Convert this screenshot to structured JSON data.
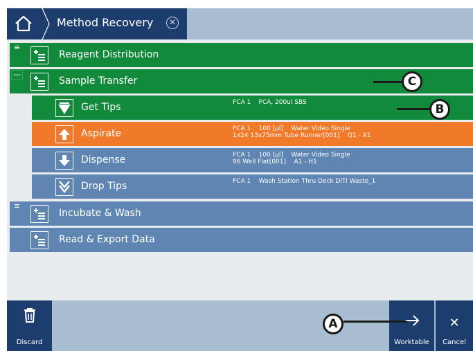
{
  "header": {
    "title": "Method Recovery"
  },
  "tree": [
    {
      "label": "Reagent Distribution",
      "expander": "≡"
    },
    {
      "label": "Sample Transfer",
      "expander": "—",
      "steps": [
        {
          "label": "Get Tips",
          "detail": "FCA 1    FCA, 200ul SBS",
          "icon": "get-tips-icon"
        },
        {
          "label": "Aspirate",
          "detail": "FCA 1    100 [µl]    Water Video Single\n1x24 13x75mm Tube Runner[001]    Q1 - X1",
          "icon": "aspirate-arrow-up-icon"
        },
        {
          "label": "Dispense",
          "detail": "FCA 1    100 [µl]    Water Video Single\n96 Well Flat[001]    A1 - H1",
          "icon": "dispense-arrow-down-icon"
        },
        {
          "label": "Drop Tips",
          "detail": "FCA 1    Wash Station Thru Deck DiTi Waste_1",
          "icon": "drop-tips-icon"
        }
      ]
    },
    {
      "label": "Incubate & Wash",
      "expander": "≡"
    },
    {
      "label": "Read & Export Data",
      "expander": ""
    }
  ],
  "callouts": {
    "a": "A",
    "b": "B",
    "c": "C"
  },
  "footer": {
    "discard": "Discard",
    "worktable": "Worktable",
    "cancel": "Cancel"
  },
  "colors": {
    "navy": "#1e3d6f",
    "green": "#128a3c",
    "orange": "#f07a2a",
    "steel": "#5f86b3",
    "light_steel": "#a8bdd2"
  }
}
